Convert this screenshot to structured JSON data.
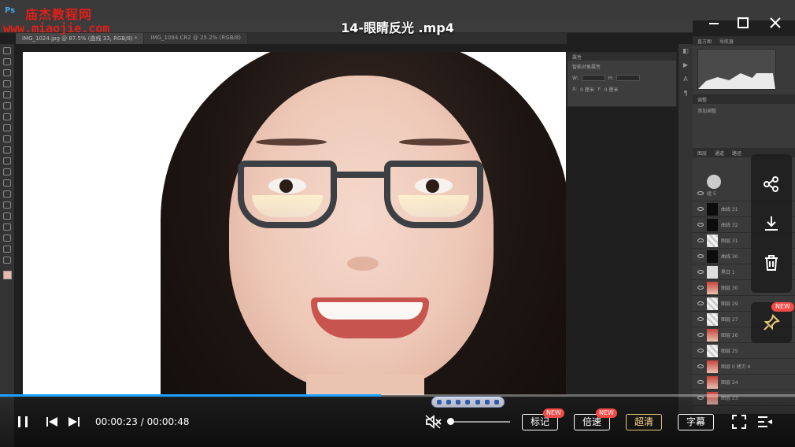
{
  "player": {
    "title": "14-眼睛反光 .mp4",
    "current_time": "00:00:23",
    "total_time": "00:00:48",
    "progress_fraction": 0.479,
    "volume_fraction": 0.0,
    "muted": true,
    "buttons": {
      "mark": "标记",
      "speed": "倍速",
      "quality": "超清",
      "subtitle": "字幕"
    },
    "badges": {
      "mark_new": "NEW",
      "speed_new": "NEW",
      "pin_new": "NEW"
    },
    "colors": {
      "progress": "#1ea0ff",
      "badge": "#f24a45",
      "quality_accent": "#ffd98a"
    }
  },
  "watermark": {
    "brand": "庙杰教程网",
    "url": "www.miaojie.com"
  },
  "photoshop": {
    "tabs": [
      {
        "label": "IMG_1024.jpg @ 87.5% (曲线 33, RGB/8) *"
      },
      {
        "label": "IMG_1094.CR2 @ 25.2% (RGB/8)"
      }
    ],
    "properties": {
      "title": "属性",
      "subtitle": "智能对象属性",
      "w_label": "W:",
      "h_label": "H:",
      "x_label": "X:",
      "y_label": "Y:",
      "x_value": "0 厘米",
      "y_value": "0 厘米"
    },
    "dock": {
      "tab_histogram": "直方图",
      "tab_navigator": "导航器",
      "tab_adjust": "调整",
      "adjust_hint": "添加调整",
      "tab_layers": "图层",
      "tab_channels": "通道",
      "tab_paths": "路径",
      "layers": [
        {
          "name": "组 5"
        },
        {
          "name": "曲线 31"
        },
        {
          "name": "曲线 32"
        },
        {
          "name": "图层 31"
        },
        {
          "name": "曲线 30"
        },
        {
          "name": "黑白 1"
        },
        {
          "name": "图层 30"
        },
        {
          "name": "图层 29"
        },
        {
          "name": "图层 27"
        },
        {
          "name": "图层 26"
        },
        {
          "name": "图层 25"
        },
        {
          "name": "图层 0 拷贝 4"
        },
        {
          "name": "图层 24"
        },
        {
          "name": "图层 23"
        }
      ]
    }
  },
  "icons": {
    "share": "share-icon",
    "download": "download-icon",
    "delete": "trash-icon",
    "pin": "pin-icon",
    "minimize": "minimize-icon",
    "maximize": "maximize-icon",
    "close": "close-icon",
    "pause": "pause-icon",
    "prev": "previous-icon",
    "next": "next-icon",
    "mute": "mute-icon",
    "fullscreen": "fullscreen-icon",
    "playlist": "playlist-icon"
  }
}
